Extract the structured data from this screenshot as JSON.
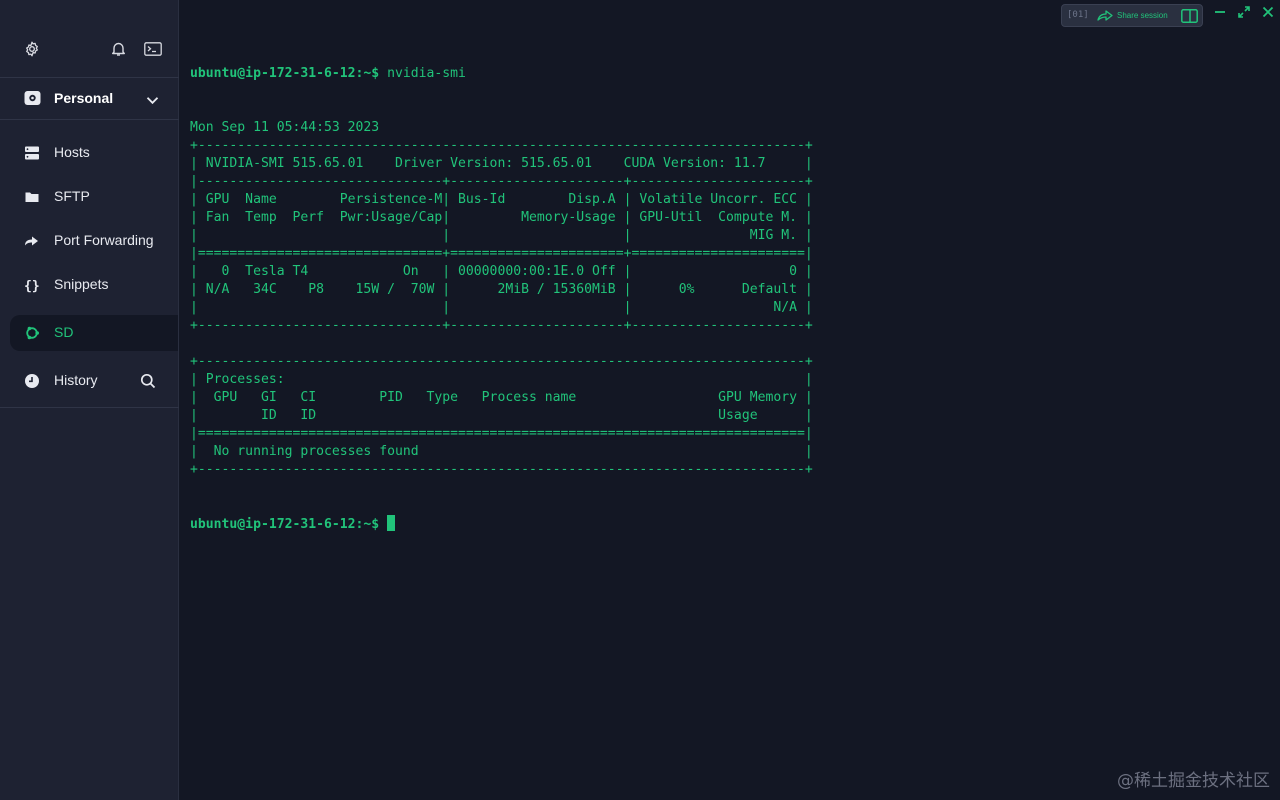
{
  "sidebar": {
    "top_icons": [
      "gear-icon",
      "bell-icon",
      "terminal-icon"
    ],
    "vault": {
      "label": "Personal",
      "icon": "vault-icon"
    },
    "nav": [
      {
        "label": "Hosts",
        "icon": "hosts-icon"
      },
      {
        "label": "SFTP",
        "icon": "folder-icon"
      },
      {
        "label": "Port Forwarding",
        "icon": "forward-icon"
      },
      {
        "label": "Snippets",
        "icon": "braces-icon"
      },
      {
        "label": "SD",
        "icon": "ubuntu-icon",
        "active": true
      },
      {
        "label": "History",
        "icon": "clock-icon"
      }
    ]
  },
  "toolbar": {
    "tag": "[01]",
    "share_label": "Share session"
  },
  "terminal": {
    "prompt": "ubuntu@ip-172-31-6-12:~$",
    "command": " nvidia-smi",
    "lines": [
      "Mon Sep 11 05:44:53 2023",
      "+-----------------------------------------------------------------------------+",
      "| NVIDIA-SMI 515.65.01    Driver Version: 515.65.01    CUDA Version: 11.7     |",
      "|-------------------------------+----------------------+----------------------+",
      "| GPU  Name        Persistence-M| Bus-Id        Disp.A | Volatile Uncorr. ECC |",
      "| Fan  Temp  Perf  Pwr:Usage/Cap|         Memory-Usage | GPU-Util  Compute M. |",
      "|                               |                      |               MIG M. |",
      "|===============================+======================+======================|",
      "|   0  Tesla T4            On   | 00000000:00:1E.0 Off |                    0 |",
      "| N/A   34C    P8    15W /  70W |      2MiB / 15360MiB |      0%      Default |",
      "|                               |                      |                  N/A |",
      "+-------------------------------+----------------------+----------------------+",
      "",
      "+-----------------------------------------------------------------------------+",
      "| Processes:                                                                  |",
      "|  GPU   GI   CI        PID   Type   Process name                  GPU Memory |",
      "|        ID   ID                                                   Usage      |",
      "|=============================================================================|",
      "|  No running processes found                                                 |",
      "+-----------------------------------------------------------------------------+"
    ]
  },
  "watermark": "@稀土掘金技术社区",
  "colors": {
    "accent": "#21c37a",
    "background": "#131724",
    "sidebar": "#1e2232"
  }
}
